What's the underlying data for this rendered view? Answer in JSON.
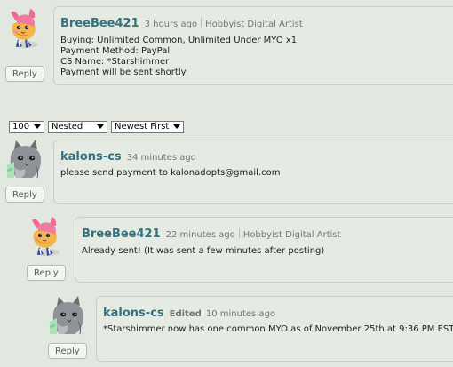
{
  "controls": {
    "per_page": "100",
    "threading": "Nested",
    "sort": "Newest First"
  },
  "comments": [
    {
      "username": "BreeBee421",
      "time": "3 hours ago",
      "user_title": "Hobbyist Digital Artist",
      "body": "Buying: Unlimited Common, Unlimited Under MYO x1\nPayment Method: PayPal\nCS Name: *Starshimmer\nPayment will be sent shortly",
      "reply_label": "Reply",
      "avatar_icon": "pink-fox-avatar-icon"
    },
    {
      "username": "kalons-cs",
      "time": "34 minutes ago",
      "body": "please send payment to kalonadopts@gmail.com",
      "reply_label": "Reply",
      "avatar_icon": "grey-creature-avatar-icon"
    },
    {
      "username": "BreeBee421",
      "time": "22 minutes ago",
      "user_title": "Hobbyist Digital Artist",
      "body": "Already sent! (It was sent a few minutes after posting)",
      "reply_label": "Reply",
      "avatar_icon": "pink-fox-avatar-icon"
    },
    {
      "username": "kalons-cs",
      "edited_label": "Edited",
      "time": "10 minutes ago",
      "body": "*Starshimmer now has one common MYO as of November 25th at 9:36 PM EST",
      "reply_label": "Reply",
      "avatar_icon": "grey-creature-avatar-icon"
    }
  ],
  "colors": {
    "background": "#e2e8e0",
    "bubble": "#e5ebe3",
    "username": "#337280"
  }
}
